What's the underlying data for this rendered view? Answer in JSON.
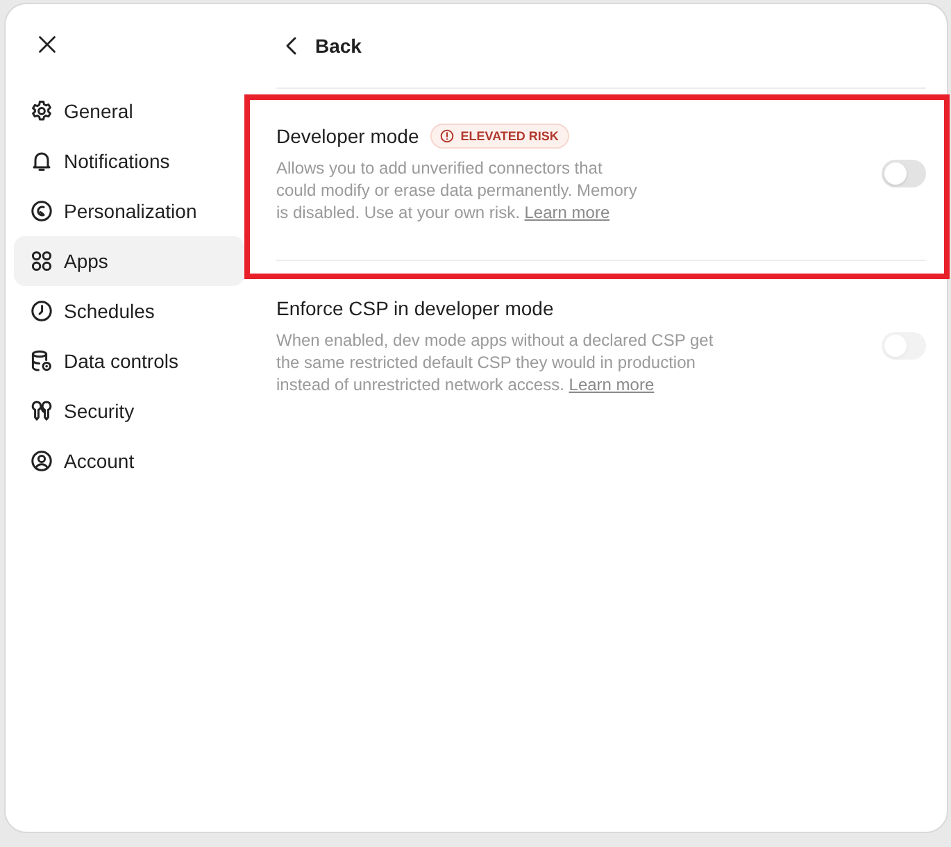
{
  "sidebar": {
    "items": [
      {
        "label": "General",
        "selected": false
      },
      {
        "label": "Notifications",
        "selected": false
      },
      {
        "label": "Personalization",
        "selected": false
      },
      {
        "label": "Apps",
        "selected": true
      },
      {
        "label": "Schedules",
        "selected": false
      },
      {
        "label": "Data controls",
        "selected": false
      },
      {
        "label": "Security",
        "selected": false
      },
      {
        "label": "Account",
        "selected": false
      }
    ]
  },
  "back_button": {
    "label": "Back"
  },
  "settings": [
    {
      "title": "Developer mode",
      "badge": "ELEVATED RISK",
      "description": "Allows you to add unverified connectors that could modify or erase data permanently. Memory is disabled. Use at your own risk.",
      "link": "Learn more",
      "on": false,
      "disabled": false,
      "highlighted": true
    },
    {
      "title": "Enforce CSP in developer mode",
      "description": "When enabled, dev mode apps without a declared CSP get the same restricted default CSP they would in production instead of unrestricted network access.",
      "link": "Learn more",
      "on": false,
      "disabled": true,
      "highlighted": false
    }
  ]
}
